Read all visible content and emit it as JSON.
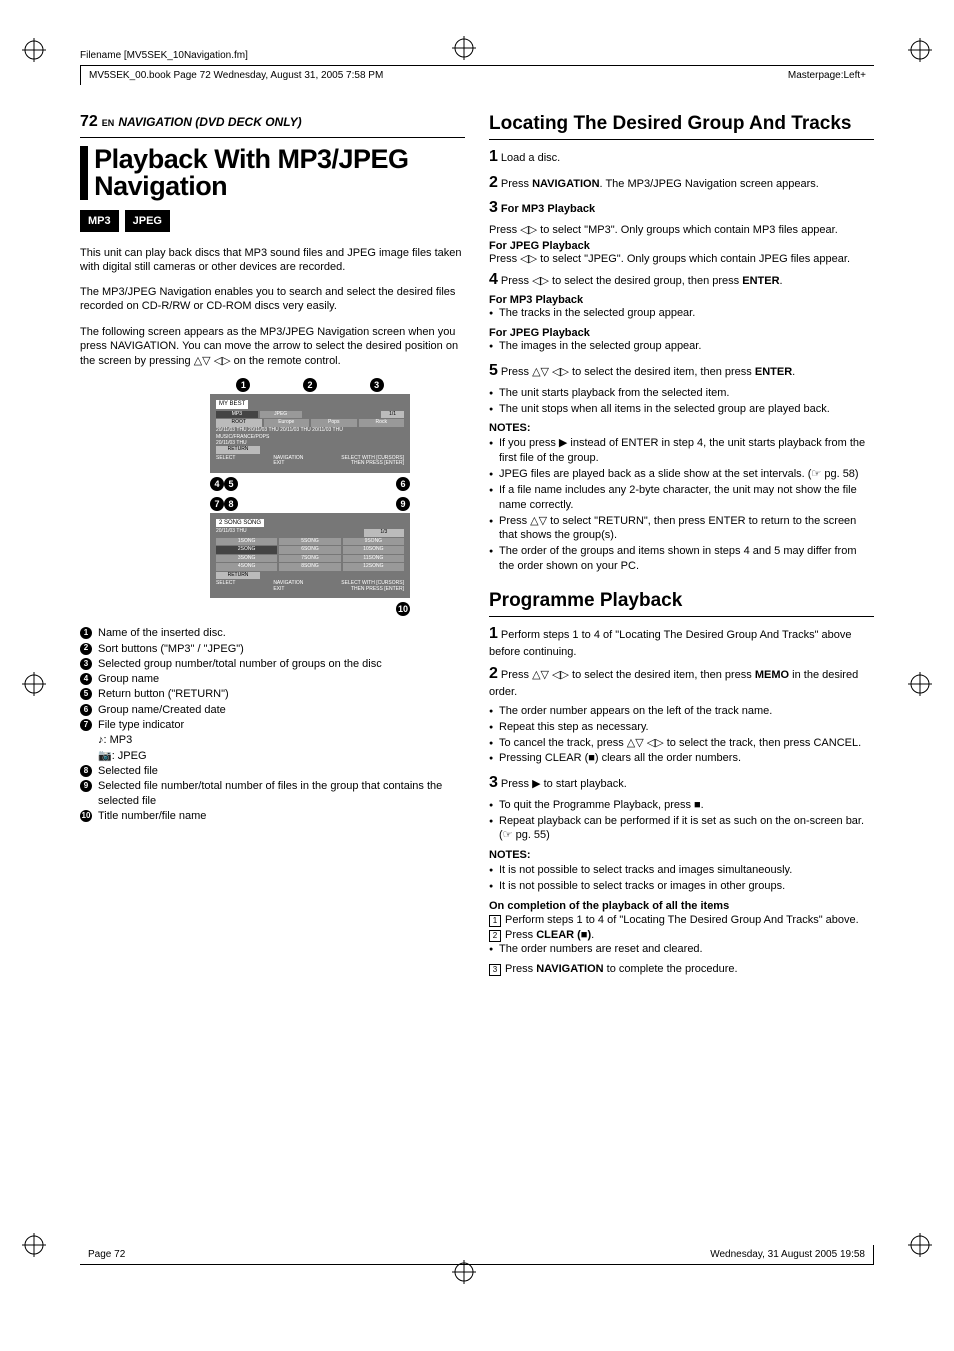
{
  "header": {
    "filename_label": "Filename [MV5SEK_10Navigation.fm]",
    "book_frame": "MV5SEK_00.book  Page 72  Wednesday, August 31, 2005  7:58 PM",
    "masterpage": "Masterpage:Left+"
  },
  "page": {
    "number": "72",
    "lang": "EN",
    "section": "NAVIGATION (DVD DECK ONLY)"
  },
  "left": {
    "title": "Playback With MP3/JPEG Navigation",
    "badges": [
      "MP3",
      "JPEG"
    ],
    "para1": "This unit can play back discs that MP3 sound files and JPEG image files taken with digital still cameras or other devices are recorded.",
    "para2": "The MP3/JPEG Navigation enables you to search and select the desired files recorded on CD-R/RW or CD-ROM discs very easily.",
    "para3": "The following screen appears as the MP3/JPEG Navigation screen when you press NAVIGATION. You can move the arrow to select the desired position on the screen by pressing △▽ ◁▷ on the remote control.",
    "screen1": {
      "disc": "MY BEST",
      "mp3": "MP3",
      "jpeg": "JPEG",
      "page": "1/1",
      "root": "ROOT",
      "groups": [
        "Europe",
        "Pops",
        "Rock"
      ],
      "dates_row": "20/11/03 THU 20/11/03 THU 20/11/03 THU 20/11/03 THU",
      "path": "MUSIC/FRANCE/POPS",
      "path_date": "20/11/03 THU",
      "return": "RETURN",
      "foot_left": "NAVIGATION\nEXIT",
      "foot_select": "SELECT",
      "foot_right": "SELECT WITH [CURSORS]\nTHEN PRESS [ENTER]"
    },
    "screen2": {
      "head": "2  SONG SONG",
      "date": "20/11/03 THU",
      "page": "1/3",
      "rows": [
        [
          "1SONG",
          "5SONG",
          "9SONG"
        ],
        [
          "2SONG",
          "6SONG",
          "10SONG"
        ],
        [
          "3SONG",
          "7SONG",
          "11SONG"
        ],
        [
          "4SONG",
          "8SONG",
          "12SONG"
        ]
      ],
      "return": "RETURN",
      "foot_left": "NAVIGATION\nEXIT",
      "foot_select": "SELECT",
      "foot_right": "SELECT WITH [CURSORS]\nTHEN PRESS [ENTER]"
    },
    "legend": [
      "Name of the inserted disc.",
      "Sort buttons (\"MP3\" / \"JPEG\")",
      "Selected group number/total number of groups on the disc",
      "Group name",
      "Return button (\"RETURN\")",
      "Group name/Created date",
      "File type indicator",
      "Selected file",
      "Selected file number/total number of files in the group that contains the selected file",
      "Title number/file name"
    ],
    "file_types": {
      "mp3": "♪:   MP3",
      "jpeg": "📷:  JPEG"
    }
  },
  "right": {
    "h_locating": "Locating The Desired Group And Tracks",
    "loc": {
      "s1": "Load a disc.",
      "s2a": "Press ",
      "s2_nav": "NAVIGATION",
      "s2b": ". The MP3/JPEG Navigation screen appears.",
      "s3_head": "For MP3 Playback",
      "s3": "Press ◁▷ to select \"MP3\". Only groups which contain MP3 files appear.",
      "s3j_head": "For JPEG Playback",
      "s3j": "Press ◁▷ to select \"JPEG\". Only groups which contain JPEG files appear.",
      "s4a": "Press ◁▷ to select the desired group, then press ",
      "s4_enter": "ENTER",
      "s4b": ".",
      "s4_mp3_head": "For MP3 Playback",
      "s4_mp3": "The tracks in the selected group appear.",
      "s4_jpeg_head": "For JPEG Playback",
      "s4_jpeg": "The images in the selected group appear.",
      "s5a": "Press △▽ ◁▷ to select the desired item, then press ",
      "s5_enter": "ENTER",
      "s5b": ".",
      "s5_b1": "The unit starts playback from the selected item.",
      "s5_b2": "The unit stops when all items in the selected group are played back."
    },
    "notes_hd": "NOTES:",
    "notes_loc": [
      "If you press ▶ instead of ENTER in step 4, the unit starts playback from the first file of the group.",
      "JPEG files are played back as a slide show at the set intervals. (☞ pg. 58)",
      "If a file name includes any 2-byte character, the unit may not show the file name correctly.",
      "Press △▽ to select \"RETURN\", then press ENTER to return to the screen that shows the group(s).",
      "The order of the groups and items shown in steps 4 and 5 may differ from the order shown on your PC."
    ],
    "h_prog": "Programme Playback",
    "prog": {
      "s1": "Perform steps 1 to 4 of \"Locating The Desired Group And Tracks\" above before continuing.",
      "s2a": "Press △▽ ◁▷ to select the desired item, then press ",
      "s2_memo": "MEMO",
      "s2b": " in the desired order.",
      "s2_bul": [
        "The order number appears on the left of the track name.",
        "Repeat this step as necessary.",
        "To cancel the track, press △▽ ◁▷ to select the track, then press CANCEL.",
        "Pressing CLEAR (■) clears all the order numbers."
      ],
      "s3": "Press ▶ to start playback.",
      "s3_bul": [
        "To quit the Programme Playback, press ■.",
        "Repeat playback can be performed if it is set as such on the on-screen bar. (☞ pg. 55)"
      ]
    },
    "notes_prog": [
      "It is not possible to select tracks and images simultaneously.",
      "It is not possible to select tracks or images in other groups."
    ],
    "completion_head": "On completion of the playback of all the items",
    "completion": {
      "l1": "Perform steps 1 to 4 of \"Locating The Desired Group And Tracks\" above.",
      "l2a": "Press ",
      "l2_clear": "CLEAR (■)",
      "l2b": ".",
      "l2_bul": "The order numbers are reset and cleared.",
      "l3a": "Press ",
      "l3_nav": "NAVIGATION",
      "l3b": " to complete the procedure."
    }
  },
  "footer": {
    "left": "Page 72",
    "right": "Wednesday, 31 August 2005  19:58"
  }
}
